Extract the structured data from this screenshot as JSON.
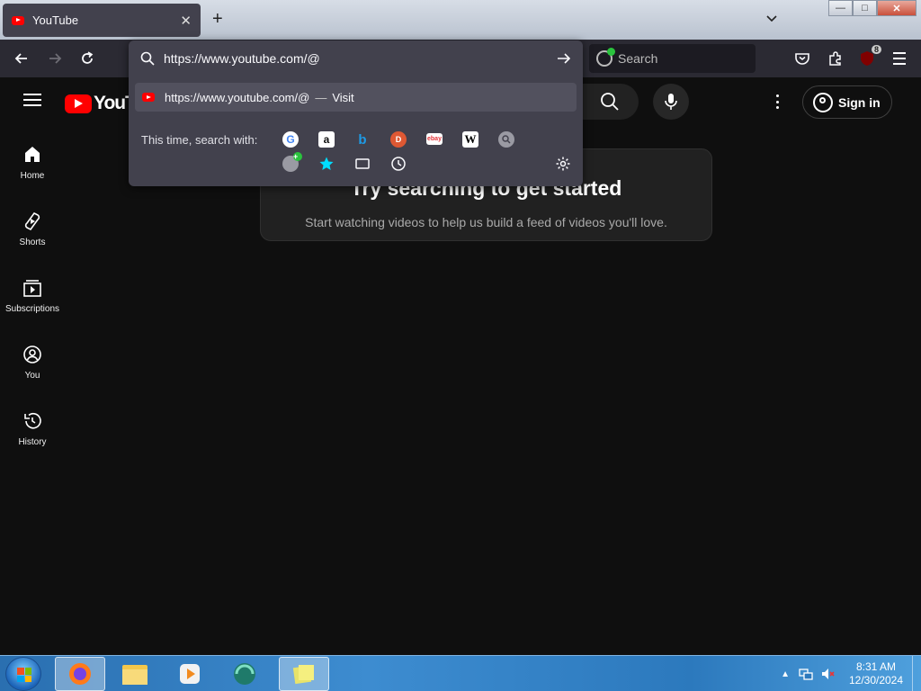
{
  "browser": {
    "tab": {
      "title": "YouTube",
      "close": "✕"
    },
    "new_tab": "+",
    "window_controls": {
      "minimize": "—",
      "maximize": "□",
      "close": "✕"
    },
    "search": {
      "placeholder": "Search"
    },
    "extension_badge": "8",
    "icons": [
      "back-arrow-icon",
      "forward-arrow-icon",
      "reload-icon",
      "pocket-icon",
      "extensions-icon",
      "ublock-icon",
      "hamburger-menu-icon"
    ]
  },
  "urlbar": {
    "value": "https://www.youtube.com/@",
    "suggestion": {
      "url": "https://www.youtube.com/@",
      "separator": "—",
      "action": "Visit"
    },
    "oneoff_label": "This time, search with:",
    "engines": [
      "Google",
      "Amazon",
      "Bing",
      "DuckDuckGo",
      "eBay",
      "Wikipedia",
      "Search engine",
      "Add engine",
      "Bookmarks",
      "Tabs",
      "History"
    ]
  },
  "youtube": {
    "logo_text": "YouTube",
    "sign_in": "Sign in",
    "sidebar": [
      {
        "label": "Home",
        "icon": "home-icon"
      },
      {
        "label": "Shorts",
        "icon": "shorts-icon"
      },
      {
        "label": "Subscriptions",
        "icon": "subscriptions-icon"
      },
      {
        "label": "You",
        "icon": "you-icon"
      },
      {
        "label": "History",
        "icon": "history-icon"
      }
    ],
    "card": {
      "title": "Try searching to get started",
      "subtitle": "Start watching videos to help us build a feed of videos you'll love."
    }
  },
  "taskbar": {
    "apps": [
      "Firefox",
      "Windows Explorer",
      "Media Player",
      "Chrome-like app",
      "Sticky Notes"
    ],
    "clock": {
      "time": "8:31 AM",
      "date": "12/30/2024"
    }
  },
  "colors": {
    "yt_red": "#ff0000",
    "browser_toolbar": "#2b2a33",
    "urlbar_panel": "#42414d",
    "page_bg": "#0f0f0f"
  }
}
